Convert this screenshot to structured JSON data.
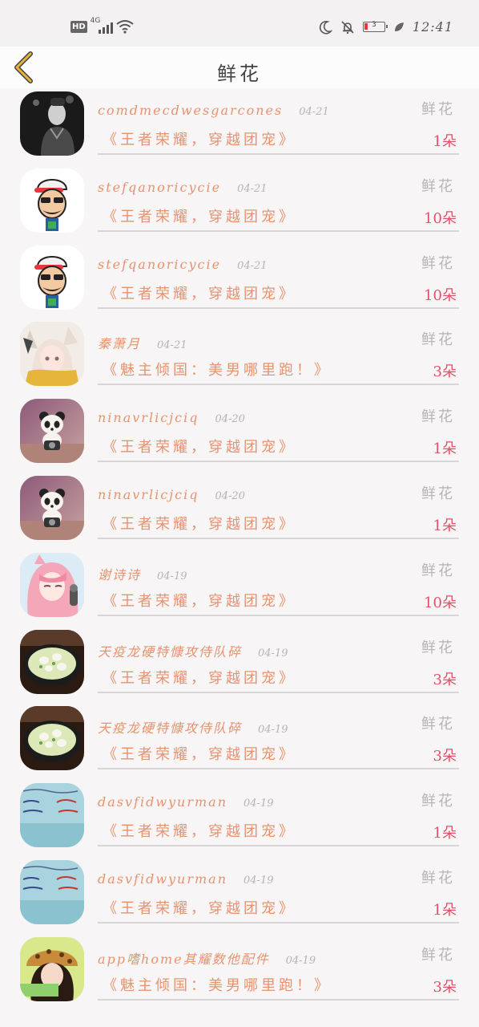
{
  "status_bar": {
    "hd": "HD",
    "network": "4G",
    "battery_level": "3",
    "time": "12:41"
  },
  "header": {
    "title": "鲜花",
    "back_icon": "chevron-left-icon",
    "accent_color": "#e8b53a"
  },
  "gifts": [
    {
      "user": "comdmecdwesgarcones",
      "date": "04-21",
      "gift": "鲜花",
      "message": "《王者荣耀，穿越团宠》",
      "quantity": "1朵",
      "avatar": "man-photo"
    },
    {
      "user": "stefqanoricycie",
      "date": "04-21",
      "gift": "鲜花",
      "message": "《王者荣耀，穿越团宠》",
      "quantity": "10朵",
      "avatar": "cartoon-man"
    },
    {
      "user": "stefqanoricycie",
      "date": "04-21",
      "gift": "鲜花",
      "message": "《王者荣耀，穿越团宠》",
      "quantity": "10朵",
      "avatar": "cartoon-man"
    },
    {
      "user": "秦萧月",
      "date": "04-21",
      "gift": "鲜花",
      "message": "《魅主倾国：美男哪里跑！》",
      "quantity": "3朵",
      "avatar": "anime-fox-girl"
    },
    {
      "user": "ninavrlicjciq",
      "date": "04-20",
      "gift": "鲜花",
      "message": "《王者荣耀，穿越团宠》",
      "quantity": "1朵",
      "avatar": "panda-toy"
    },
    {
      "user": "ninavrlicjciq",
      "date": "04-20",
      "gift": "鲜花",
      "message": "《王者荣耀，穿越团宠》",
      "quantity": "1朵",
      "avatar": "panda-toy"
    },
    {
      "user": "谢诗诗",
      "date": "04-19",
      "gift": "鲜花",
      "message": "《王者荣耀，穿越团宠》",
      "quantity": "10朵",
      "avatar": "anime-pink-hair"
    },
    {
      "user": "天疫龙硬特慷攻侍队碎",
      "date": "04-19",
      "gift": "鲜花",
      "message": "《王者荣耀，穿越团宠》",
      "quantity": "3朵",
      "avatar": "soup-bowl"
    },
    {
      "user": "天疫龙硬特慷攻侍队碎",
      "date": "04-19",
      "gift": "鲜花",
      "message": "《王者荣耀，穿越团宠》",
      "quantity": "3朵",
      "avatar": "soup-bowl"
    },
    {
      "user": "dasvfidwyurman",
      "date": "04-19",
      "gift": "鲜花",
      "message": "《王者荣耀，穿越团宠》",
      "quantity": "1朵",
      "avatar": "handwriting-note"
    },
    {
      "user": "dasvfidwyurman",
      "date": "04-19",
      "gift": "鲜花",
      "message": "《王者荣耀，穿越团宠》",
      "quantity": "1朵",
      "avatar": "handwriting-note"
    },
    {
      "user": "app嗜home其耀数他配件",
      "date": "04-19",
      "gift": "鲜花",
      "message": "《魅主倾国：美男哪里跑！》",
      "quantity": "3朵",
      "avatar": "girl-leopard-hat"
    }
  ]
}
